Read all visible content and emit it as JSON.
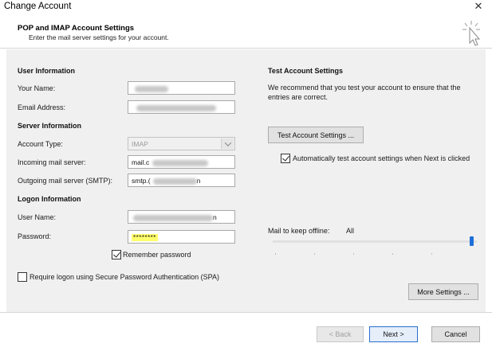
{
  "window": {
    "title": "Change Account"
  },
  "header": {
    "title": "POP and IMAP Account Settings",
    "subtitle": "Enter the mail server settings for your account."
  },
  "user_info": {
    "heading": "User Information",
    "name_label": "Your Name:",
    "email_label": "Email Address:"
  },
  "server_info": {
    "heading": "Server Information",
    "account_type_label": "Account Type:",
    "account_type_value": "IMAP",
    "incoming_label": "Incoming mail server:",
    "incoming_value_prefix": "mail.c",
    "outgoing_label": "Outgoing mail server (SMTP):",
    "outgoing_value_prefix": "smtp.(",
    "outgoing_value_suffix": "n"
  },
  "logon_info": {
    "heading": "Logon Information",
    "username_label": "User Name:",
    "username_value_suffix": "n",
    "password_label": "Password:",
    "password_value": "********",
    "remember_label": "Remember password",
    "remember_checked": true,
    "spa_label": "Require logon using Secure Password Authentication (SPA)",
    "spa_checked": false
  },
  "test_settings": {
    "heading": "Test Account Settings",
    "description": "We recommend that you test your account to ensure that the entries are correct.",
    "test_button": "Test Account Settings ...",
    "auto_test_label": "Automatically test account settings when Next is clicked",
    "auto_test_checked": true
  },
  "offline": {
    "label": "Mail to keep offline:",
    "value": "All"
  },
  "buttons": {
    "more_settings": "More Settings ...",
    "back": "< Back",
    "next": "Next >",
    "cancel": "Cancel"
  },
  "colors": {
    "accent": "#1e6fd8",
    "password_highlight": "#fffe6b"
  }
}
